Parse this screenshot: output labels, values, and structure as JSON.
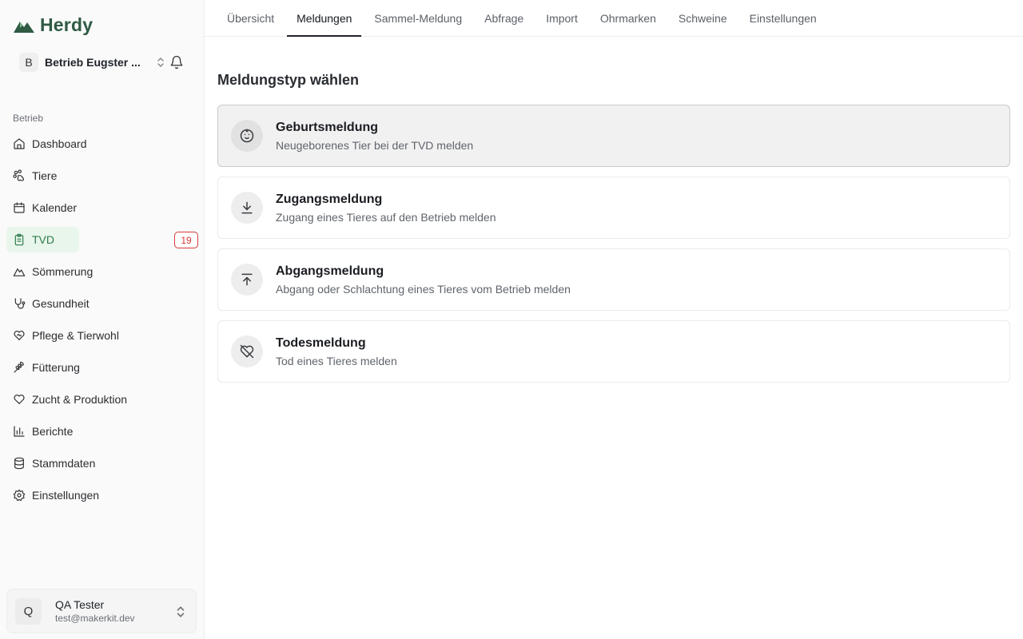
{
  "app": {
    "name": "Herdy",
    "brand_color": "#2f5a44"
  },
  "farm": {
    "initial": "B",
    "name": "Betrieb Eugster ..."
  },
  "sidebar": {
    "section_label": "Betrieb",
    "items": [
      {
        "label": "Dashboard",
        "icon": "home-icon"
      },
      {
        "label": "Tiere",
        "icon": "paw-icon"
      },
      {
        "label": "Kalender",
        "icon": "calendar-icon"
      },
      {
        "label": "TVD",
        "icon": "clipboard-icon",
        "active": true,
        "badge": "19"
      },
      {
        "label": "Sömmerung",
        "icon": "mountain-icon"
      },
      {
        "label": "Gesundheit",
        "icon": "stethoscope-icon"
      },
      {
        "label": "Pflege & Tierwohl",
        "icon": "heart-handshake-icon"
      },
      {
        "label": "Fütterung",
        "icon": "wheat-icon"
      },
      {
        "label": "Zucht & Produktion",
        "icon": "heart-icon"
      },
      {
        "label": "Berichte",
        "icon": "bar-chart-icon"
      },
      {
        "label": "Stammdaten",
        "icon": "database-icon"
      },
      {
        "label": "Einstellungen",
        "icon": "gear-icon"
      }
    ]
  },
  "user": {
    "initial": "Q",
    "name": "QA Tester",
    "email": "test@makerkit.dev"
  },
  "tabs": [
    {
      "label": "Übersicht"
    },
    {
      "label": "Meldungen",
      "active": true
    },
    {
      "label": "Sammel-Meldung"
    },
    {
      "label": "Abfrage"
    },
    {
      "label": "Import"
    },
    {
      "label": "Ohrmarken"
    },
    {
      "label": "Schweine"
    },
    {
      "label": "Einstellungen"
    }
  ],
  "main": {
    "title": "Meldungstyp wählen",
    "cards": [
      {
        "title": "Geburtsmeldung",
        "description": "Neugeborenes Tier bei der TVD melden",
        "icon": "baby-icon",
        "selected": true
      },
      {
        "title": "Zugangsmeldung",
        "description": "Zugang eines Tieres auf den Betrieb melden",
        "icon": "download-icon"
      },
      {
        "title": "Abgangsmeldung",
        "description": "Abgang oder Schlachtung eines Tieres vom Betrieb melden",
        "icon": "upload-icon"
      },
      {
        "title": "Todesmeldung",
        "description": "Tod eines Tieres melden",
        "icon": "heart-off-icon"
      }
    ]
  },
  "colors": {
    "active_green": "#2e7d4a",
    "active_bg": "#e9f6ec",
    "badge_red": "#d53a3a"
  }
}
